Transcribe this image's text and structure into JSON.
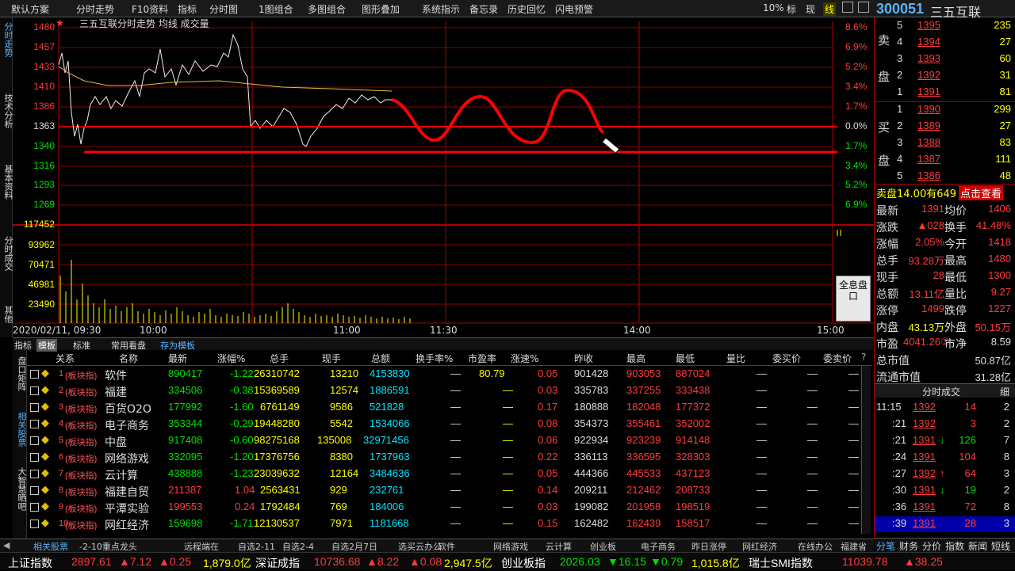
{
  "menu": [
    "默认方案",
    "分时走势",
    "F10资料",
    "指标",
    "分时图",
    "1图组合",
    "多图组合",
    "图形叠加",
    "系统指示",
    "备忘录",
    "历史回忆",
    "闪电预警",
    "10%",
    "标",
    "现",
    "线"
  ],
  "stock": {
    "code": "300051",
    "name": "三五互联"
  },
  "chart_title": "三五互联分时走势 均线 成交量",
  "left_tabs": [
    "分时走势",
    "技术分析",
    "基本资料",
    "分时成交",
    "其他"
  ],
  "price_axis": [
    "1480",
    "1457",
    "1433",
    "1410",
    "1386",
    "1363",
    "1340",
    "1316",
    "1293",
    "1269"
  ],
  "pct_axis": [
    "8.6%",
    "6.9%",
    "5.2%",
    "3.4%",
    "1.7%",
    "0.0%",
    "1.7%",
    "3.4%",
    "5.2%",
    "6.9%"
  ],
  "vol_axis": [
    "117452",
    "93962",
    "70471",
    "46981",
    "23490"
  ],
  "time_axis": [
    "2020/02/11, 09:30",
    "10:00",
    "11:00",
    "11:30",
    "14:00",
    "15:00"
  ],
  "quote_btn": "全息盘口",
  "tabs": [
    "指标",
    "模板",
    "标准",
    "常用看盘",
    "存为模板"
  ],
  "side_tabs": [
    "盘口矩阵",
    "相关股票",
    "大智慧晒吧"
  ],
  "columns": [
    "关系",
    "名称",
    "最新",
    "涨幅%",
    "总手",
    "现手",
    "总额",
    "换手率%",
    "市盈率",
    "涨速%",
    "昨收",
    "最高",
    "最低",
    "量比",
    "委买价",
    "委卖价"
  ],
  "rows": [
    {
      "n": "1",
      "t": "(板块指)",
      "name": "软件",
      "last": "890417",
      "chg": "-1.22",
      "vol": "26310742",
      "cur": "13210",
      "amt": "4153830",
      "tr": "—",
      "pe": "80.79",
      "spd": "0.05",
      "prev": "901428",
      "high": "903053",
      "low": "887024"
    },
    {
      "n": "2",
      "t": "(板块指)",
      "name": "福建",
      "last": "334506",
      "chg": "-0.38",
      "vol": "15369589",
      "cur": "12574",
      "amt": "1886591",
      "tr": "—",
      "pe": "—",
      "spd": "0.03",
      "prev": "335783",
      "high": "337255",
      "low": "333438"
    },
    {
      "n": "3",
      "t": "(板块指)",
      "name": "百货O2O",
      "last": "177992",
      "chg": "-1.60",
      "vol": "6761149",
      "cur": "9586",
      "amt": "521828",
      "tr": "—",
      "pe": "—",
      "spd": "0.17",
      "prev": "180888",
      "high": "182048",
      "low": "177372"
    },
    {
      "n": "4",
      "t": "(板块指)",
      "name": "电子商务",
      "last": "353344",
      "chg": "-0.29",
      "vol": "19448280",
      "cur": "5542",
      "amt": "1534066",
      "tr": "—",
      "pe": "—",
      "spd": "0.08",
      "prev": "354373",
      "high": "355461",
      "low": "352002"
    },
    {
      "n": "5",
      "t": "(板块指)",
      "name": "中盘",
      "last": "917408",
      "chg": "-0.60",
      "vol": "98275168",
      "cur": "135008",
      "amt": "32971456",
      "tr": "—",
      "pe": "—",
      "spd": "0.06",
      "prev": "922934",
      "high": "923239",
      "low": "914148"
    },
    {
      "n": "6",
      "t": "(板块指)",
      "name": "网络游戏",
      "last": "332095",
      "chg": "-1.20",
      "vol": "17376756",
      "cur": "8380",
      "amt": "1737963",
      "tr": "—",
      "pe": "—",
      "spd": "0.22",
      "prev": "336113",
      "high": "336595",
      "low": "328303"
    },
    {
      "n": "7",
      "t": "(板块指)",
      "name": "云计算",
      "last": "438888",
      "chg": "-1.23",
      "vol": "23039632",
      "cur": "12164",
      "amt": "3484636",
      "tr": "—",
      "pe": "—",
      "spd": "0.05",
      "prev": "444366",
      "high": "445533",
      "low": "437123"
    },
    {
      "n": "8",
      "t": "(板块指)",
      "name": "福建自贸",
      "last": "211387",
      "chg": "1.04",
      "vol": "2563431",
      "cur": "929",
      "amt": "232761",
      "tr": "—",
      "pe": "—",
      "spd": "0.14",
      "prev": "209211",
      "high": "212462",
      "low": "208733"
    },
    {
      "n": "9",
      "t": "(板块指)",
      "name": "平潭实验",
      "last": "199553",
      "chg": "0.24",
      "vol": "1792484",
      "cur": "769",
      "amt": "184006",
      "tr": "—",
      "pe": "—",
      "spd": "0.03",
      "prev": "199082",
      "high": "201958",
      "low": "198519"
    },
    {
      "n": "10",
      "t": "(板块指)",
      "name": "网红经济",
      "last": "159698",
      "chg": "-1.71",
      "vol": "12130537",
      "cur": "7971",
      "amt": "1181668",
      "tr": "—",
      "pe": "—",
      "spd": "0.15",
      "prev": "162482",
      "high": "162439",
      "low": "158517"
    }
  ],
  "bottom_nav": [
    "相关股票",
    "-2-10重点龙头",
    "远程端在",
    "自选2-11",
    "自选2-4",
    "自选2月7日",
    "选买云办公",
    "软件",
    "网络游戏",
    "云计算",
    "创业板",
    "电子商务",
    "昨日涨停",
    "网红经济",
    "在线办公",
    "福建省",
    "其他"
  ],
  "ticker": {
    "a_name": "上证指数",
    "a_val": "2897.61",
    "a_chg": "▲7.12",
    "a_pct": "▲0.25",
    "a_amt": "1,879.0亿",
    "b_name": "深证成指",
    "b_val": "10736.68",
    "b_chg": "▲8.22",
    "b_pct": "▲0.08",
    "b_amt": "2,947.5亿",
    "c_name": "创业板指",
    "c_val": "2026.03",
    "c_chg": "▼16.15",
    "c_pct": "▼0.79",
    "c_amt": "1,015.8亿",
    "d_name": "瑞士SMI指数",
    "d_val": "11039.78",
    "d_chg": "▲38.25"
  },
  "asks": [
    {
      "lv": "5",
      "p": "1395",
      "v": "235"
    },
    {
      "lv": "4",
      "p": "1394",
      "v": "27"
    },
    {
      "lv": "3",
      "p": "1393",
      "v": "60"
    },
    {
      "lv": "2",
      "p": "1392",
      "v": "31"
    },
    {
      "lv": "1",
      "p": "1391",
      "v": "81"
    }
  ],
  "bids": [
    {
      "lv": "1",
      "p": "1390",
      "v": "299"
    },
    {
      "lv": "2",
      "p": "1389",
      "v": "27"
    },
    {
      "lv": "3",
      "p": "1388",
      "v": "83"
    },
    {
      "lv": "4",
      "p": "1387",
      "v": "111"
    },
    {
      "lv": "5",
      "p": "1386",
      "v": "48"
    }
  ],
  "ask_label": [
    "卖",
    "盘"
  ],
  "bid_label": [
    "买",
    "盘"
  ],
  "sellpan": "卖盘14.00有649",
  "click_view": "点击查看",
  "stats": [
    {
      "l": "最新",
      "v": "1391",
      "l2": "均价",
      "v2": "1406"
    },
    {
      "l": "涨跌",
      "v": "▲028",
      "l2": "换手",
      "v2": "41.48%"
    },
    {
      "l": "涨幅",
      "v": "2.05%",
      "l2": "今开",
      "v2": "1418"
    },
    {
      "l": "总手",
      "v": "93.28万",
      "l2": "最高",
      "v2": "1480"
    },
    {
      "l": "现手",
      "v": "28",
      "l2": "最低",
      "v2": "1300"
    },
    {
      "l": "总额",
      "v": "13.11亿",
      "l2": "量比",
      "v2": "9.27"
    },
    {
      "l": "涨停",
      "v": "1499",
      "l2": "跌停",
      "v2": "1227"
    },
    {
      "l": "内盘",
      "v": "43.13万",
      "l2": "外盘",
      "v2": "50.15万"
    },
    {
      "l": "市盈",
      "v": "4041.26③",
      "l2": "市净",
      "v2": "8.59"
    },
    {
      "l": "总市值",
      "v": "",
      "l2": "",
      "v2": "50.87亿"
    },
    {
      "l": "流通市值",
      "v": "",
      "l2": "",
      "v2": "31.28亿"
    }
  ],
  "trades_title": "分时成交",
  "trades_fine": "细",
  "trades": [
    {
      "t": "11:15",
      "p": "1392",
      "v": "14",
      "n": "2",
      "d": ""
    },
    {
      "t": ":21",
      "p": "1392",
      "v": "3",
      "n": "2",
      "d": ""
    },
    {
      "t": ":21",
      "p": "1391",
      "v": "126",
      "n": "7",
      "d": "down"
    },
    {
      "t": ":24",
      "p": "1391",
      "v": "104",
      "n": "8",
      "d": ""
    },
    {
      "t": ":27",
      "p": "1392",
      "v": "64",
      "n": "3",
      "d": "up"
    },
    {
      "t": ":30",
      "p": "1391",
      "v": "19",
      "n": "2",
      "d": "down"
    },
    {
      "t": ":36",
      "p": "1391",
      "v": "72",
      "n": "8",
      "d": ""
    },
    {
      "t": ":39",
      "p": "1391",
      "v": "28",
      "n": "3",
      "d": ""
    }
  ],
  "right_tabs": [
    "分笔",
    "财务",
    "分价",
    "指数",
    "新闻",
    "短线"
  ],
  "colors": {
    "up": "#ff3b3b",
    "down": "#00e000",
    "axis": "#c00000",
    "text": "#dddddd"
  }
}
